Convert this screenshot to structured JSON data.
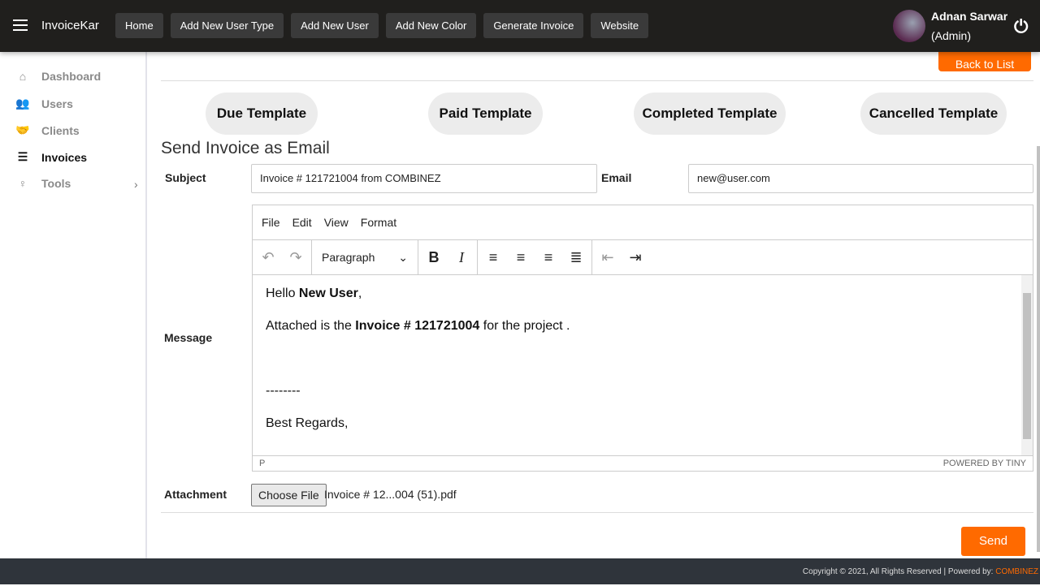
{
  "header": {
    "brand": "InvoiceKar",
    "nav": [
      "Home",
      "Add New User Type",
      "Add New User",
      "Add New Color",
      "Generate Invoice",
      "Website"
    ],
    "user_name": "Adnan Sarwar",
    "user_role": "(Admin)"
  },
  "sidebar": {
    "items": [
      {
        "label": "Dashboard",
        "icon": "home-icon"
      },
      {
        "label": "Users",
        "icon": "users-icon"
      },
      {
        "label": "Clients",
        "icon": "handshake-icon"
      },
      {
        "label": "Invoices",
        "icon": "list-icon"
      },
      {
        "label": "Tools",
        "icon": "pin-icon"
      }
    ]
  },
  "main": {
    "back_label": "Back to List",
    "templates": [
      "Due Template",
      "Paid Template",
      "Completed Template",
      "Cancelled Template"
    ],
    "title": "Send Invoice as Email",
    "subject_label": "Subject",
    "subject_value": "Invoice # 121721004 from COMBINEZ",
    "email_label": "Email",
    "email_value": "new@user.com",
    "message_label": "Message",
    "attachment_label": "Attachment",
    "choose_file": "Choose File",
    "file_name": "Invoice # 12...004 (51).pdf",
    "send_label": "Send"
  },
  "editor": {
    "menu": [
      "File",
      "Edit",
      "View",
      "Format"
    ],
    "block_format": "Paragraph",
    "hello": "Hello ",
    "hello_name": "New User",
    "hello_end": ",",
    "line2_a": "Attached is the ",
    "line2_b": "Invoice # 121721004",
    "line2_c": " for the project .",
    "sep": "--------",
    "regards": "Best Regards,",
    "status_path": "P",
    "powered": "POWERED BY TINY"
  },
  "footer": {
    "copyright": "Copyright © 2021, All Rights Reserved | Powered by: ",
    "company": "COMBINEZ"
  },
  "colors": {
    "accent": "#ff6a00",
    "header": "#201f1d",
    "footer": "#2f343b"
  }
}
